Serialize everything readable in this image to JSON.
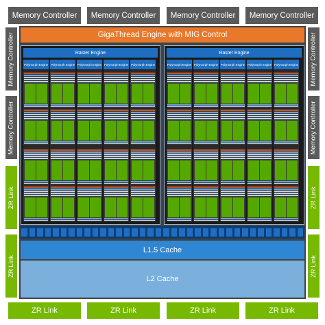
{
  "memory_controllers_top": [
    "Memory Controller",
    "Memory Controller",
    "Memory Controller",
    "Memory Controller"
  ],
  "memory_controllers_left": [
    "Memory Controller",
    "Memory Controller"
  ],
  "memory_controllers_right": [
    "Memory Controller",
    "Memory Controller"
  ],
  "zr_links_left": [
    "ZR Link",
    "ZR Link"
  ],
  "zr_links_right": [
    "ZR Link",
    "ZR Link"
  ],
  "zr_links_bottom": [
    "ZR Link",
    "ZR Link",
    "ZR Link",
    "ZR Link"
  ],
  "giga_thread_label": "GigaThread Engine with MIG Control",
  "gpcs": [
    {
      "raster_label": "Raster Engine",
      "polymorph_labels": [
        "Polymorph Engine",
        "Polymorph Engine",
        "Polymorph Engine",
        "Polymorph Engine",
        "Polymorph Engine"
      ]
    },
    {
      "raster_label": "Raster Engine",
      "polymorph_labels": [
        "Polymorph Engine",
        "Polymorph Engine",
        "Polymorph Engine",
        "Polymorph Engine",
        "Polymorph Engine"
      ]
    }
  ],
  "l15_cache_label": "L1.5 Cache",
  "l2_cache_label": "L2 Cache",
  "colors": {
    "memory_controller": "#5a5a5a",
    "zr_link": "#76b900",
    "giga_thread": "#e8792a",
    "raster_engine": "#1e6fc2",
    "core": "#55a800",
    "l15_cache": "#2f87d3",
    "l2_cache": "#7bafdc"
  }
}
